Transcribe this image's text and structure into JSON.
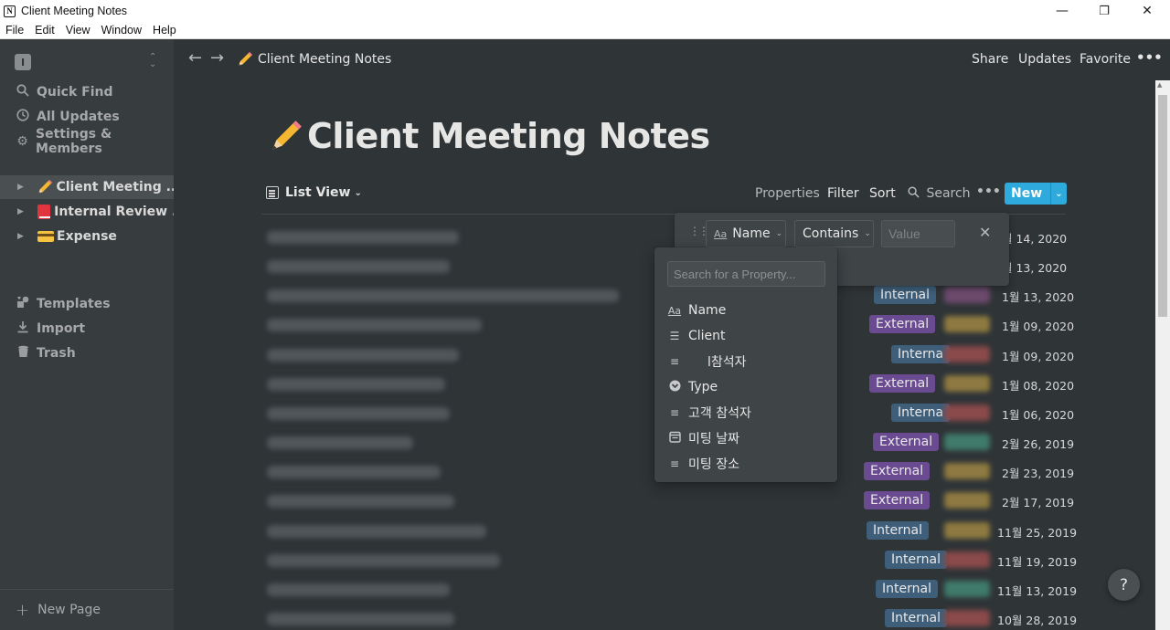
{
  "window": {
    "title": "Client Meeting Notes",
    "app_icon_letter": "N",
    "minimize": "—",
    "restore": "❐",
    "close": "✕"
  },
  "menubar": [
    "File",
    "Edit",
    "View",
    "Window",
    "Help"
  ],
  "sidebar": {
    "workspace_initial": "I",
    "nav": [
      {
        "label": "Quick Find",
        "icon": "search-icon"
      },
      {
        "label": "All Updates",
        "icon": "clock-icon"
      },
      {
        "label": "Settings & Members",
        "icon": "gear-icon"
      }
    ],
    "pages": [
      {
        "label": "Client Meeting ...",
        "icon": "pencil-emoji",
        "active": true
      },
      {
        "label": "Internal Review ...",
        "icon": "red-book-emoji",
        "active": false
      },
      {
        "label": "Expense",
        "icon": "credit-card-emoji",
        "active": false
      }
    ],
    "bottom_nav": [
      {
        "label": "Templates",
        "icon": "templates-icon"
      },
      {
        "label": "Import",
        "icon": "import-icon"
      },
      {
        "label": "Trash",
        "icon": "trash-icon"
      }
    ],
    "new_page": "New Page"
  },
  "topbar": {
    "breadcrumb": "Client Meeting Notes",
    "share": "Share",
    "updates": "Updates",
    "favorite": "Favorite",
    "more": "•••"
  },
  "page": {
    "title": "Client Meeting Notes",
    "view_name": "List View",
    "toolbar": {
      "properties": "Properties",
      "filter": "Filter",
      "sort": "Sort",
      "search": "Search",
      "more": "•••",
      "new": "New"
    }
  },
  "rows": [
    {
      "type": "",
      "date": "월 14, 2020"
    },
    {
      "type": "",
      "date": "월 13, 2020"
    },
    {
      "type": "Internal",
      "date": "1월 13, 2020"
    },
    {
      "type": "External",
      "date": "1월 09, 2020"
    },
    {
      "type": "Interna",
      "date": "1월 09, 2020"
    },
    {
      "type": "External",
      "date": "1월 08, 2020"
    },
    {
      "type": "Interna",
      "date": "1월 06, 2020"
    },
    {
      "type": "External",
      "date": "2월 26, 2019"
    },
    {
      "type": "External",
      "date": "2월 23, 2019"
    },
    {
      "type": "External",
      "date": "2월 17, 2019"
    },
    {
      "type": "Internal",
      "date": "11월 25, 2019"
    },
    {
      "type": "Internal",
      "date": "11월 19, 2019"
    },
    {
      "type": "Internal",
      "date": "11월 13, 2019"
    },
    {
      "type": "Internal",
      "date": "10월 28, 2019"
    }
  ],
  "filter": {
    "property_label": "Name",
    "condition": "Contains",
    "value_placeholder": "Value",
    "close": "✕"
  },
  "property_menu": {
    "search_placeholder": "Search for a Property...",
    "items": [
      {
        "label": "Name",
        "icon": "title-icon"
      },
      {
        "label": "Client",
        "icon": "multi-select-icon"
      },
      {
        "label": "l참석자",
        "icon": "text-icon"
      },
      {
        "label": "Type",
        "icon": "select-icon"
      },
      {
        "label": "고객 참석자",
        "icon": "text-icon"
      },
      {
        "label": "미팅 날짜",
        "icon": "date-icon"
      },
      {
        "label": "미팅 장소",
        "icon": "text-icon"
      }
    ]
  },
  "help": "?",
  "colors": {
    "background": "#2f3437",
    "sidebar": "#373c3f",
    "accent": "#2eaadc",
    "internal_tag": "#3e5e7a",
    "external_tag": "#6a4a90"
  }
}
